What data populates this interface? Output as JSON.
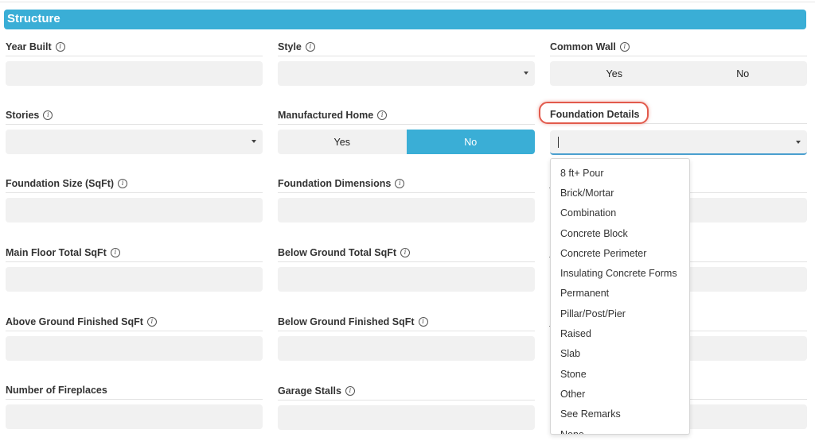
{
  "section": {
    "title": "Structure"
  },
  "fields": {
    "year_built": {
      "label": "Year Built"
    },
    "style": {
      "label": "Style"
    },
    "common_wall": {
      "label": "Common Wall",
      "options": [
        "Yes",
        "No"
      ]
    },
    "stories": {
      "label": "Stories"
    },
    "manufactured_home": {
      "label": "Manufactured Home",
      "options": [
        "Yes",
        "No"
      ],
      "selected": "No"
    },
    "foundation_details": {
      "label": "Foundation Details"
    },
    "foundation_size": {
      "label": "Foundation Size (SqFt)"
    },
    "foundation_dimensions": {
      "label": "Foundation Dimensions"
    },
    "main_floor_total": {
      "label": "Main Floor Total SqFt"
    },
    "below_ground_total": {
      "label": "Below Ground Total SqFt"
    },
    "above_ground_finished": {
      "label": "Above Ground Finished SqFt"
    },
    "below_ground_finished": {
      "label": "Below Ground Finished SqFt"
    },
    "fireplaces": {
      "label": "Number of Fireplaces"
    },
    "garage_stalls": {
      "label": "Garage Stalls"
    }
  },
  "foundation_dropdown": {
    "options": [
      "8 ft+ Pour",
      "Brick/Mortar",
      "Combination",
      "Concrete Block",
      "Concrete Perimeter",
      "Insulating Concrete Forms",
      "Permanent",
      "Pillar/Post/Pier",
      "Raised",
      "Slab",
      "Stone",
      "Other",
      "See Remarks",
      "None"
    ]
  },
  "colors": {
    "accent": "#3aaed6",
    "highlight": "#e25a4c",
    "field_bg": "#f1f1f1"
  },
  "icons": {
    "info": "info-circle-icon",
    "caret": "caret-down-icon"
  }
}
